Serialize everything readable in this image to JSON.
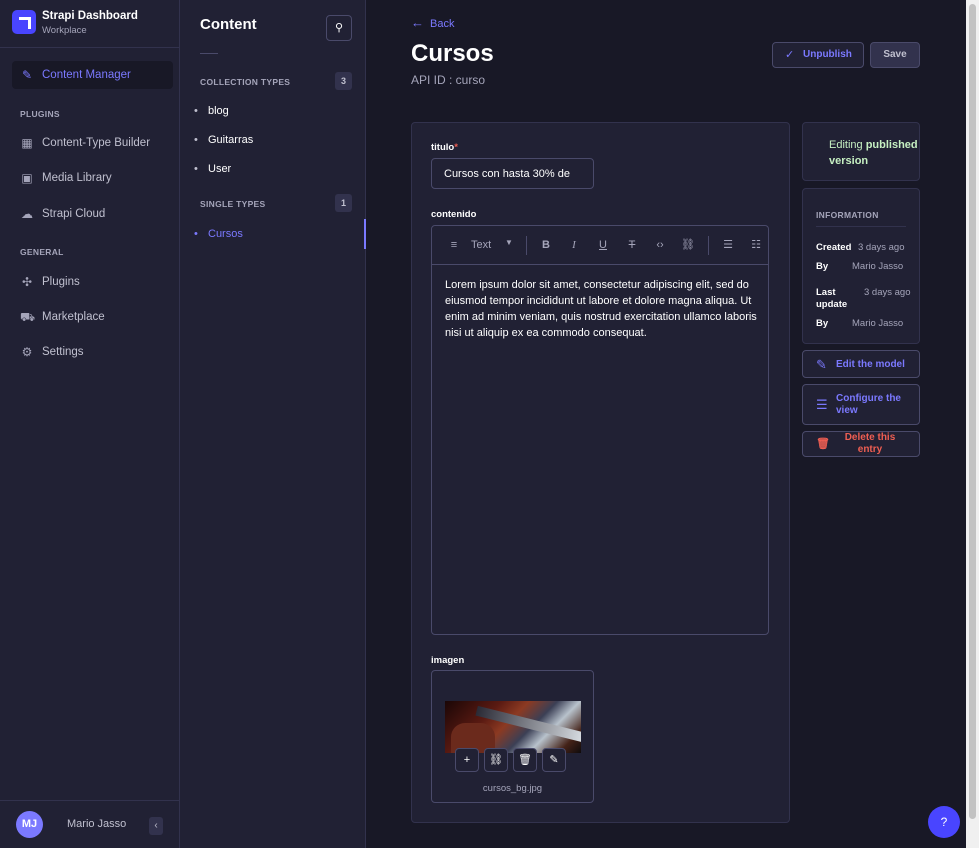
{
  "brand": {
    "title": "Strapi Dashboard",
    "subtitle": "Workplace"
  },
  "main_nav": {
    "content_manager": "Content Manager",
    "plugins_header": "PLUGINS",
    "plugins": [
      {
        "label": "Content-Type Builder",
        "icon": "layout-icon"
      },
      {
        "label": "Media Library",
        "icon": "image-icon"
      },
      {
        "label": "Strapi Cloud",
        "icon": "cloud-icon"
      }
    ],
    "general_header": "GENERAL",
    "general": [
      {
        "label": "Plugins",
        "icon": "puzzle-icon"
      },
      {
        "label": "Marketplace",
        "icon": "cart-icon"
      },
      {
        "label": "Settings",
        "icon": "gear-icon"
      }
    ]
  },
  "profile": {
    "initials": "MJ",
    "name": "Mario Jasso"
  },
  "sub_nav": {
    "title": "Content",
    "collection_header": "COLLECTION TYPES",
    "collection_count": "3",
    "collection_items": [
      "blog",
      "Guitarras",
      "User"
    ],
    "single_header": "SINGLE TYPES",
    "single_count": "1",
    "single_items": [
      "Cursos"
    ]
  },
  "header": {
    "back": "Back",
    "title": "Cursos",
    "api_id": "API ID : curso",
    "unpublish": "Unpublish",
    "save": "Save"
  },
  "form": {
    "titulo_label": "titulo",
    "titulo_required": "*",
    "titulo_value": "Cursos con hasta 30% de",
    "contenido_label": "contenido",
    "toolbar_text": "Text",
    "contenido_value": "Lorem ipsum dolor sit amet, consectetur adipiscing elit, sed do eiusmod tempor incididunt ut labore et dolore magna aliqua. Ut enim ad minim veniam, quis nostrud exercitation ullamco laboris nisi ut aliquip ex ea commodo consequat.",
    "imagen_label": "imagen",
    "image_filename": "cursos_bg.jpg"
  },
  "status": {
    "prefix": "Editing",
    "emphasis": "published version"
  },
  "information": {
    "title": "INFORMATION",
    "created_label": "Created",
    "created_value": "3 days ago",
    "by_label": "By",
    "created_by": "Mario Jasso",
    "updated_label": "Last update",
    "updated_value": "3 days ago",
    "updated_by": "Mario Jasso"
  },
  "actions": {
    "edit_model": "Edit the model",
    "configure_view": "Configure the view",
    "delete_entry": "Delete this entry"
  },
  "help": "?",
  "colors": {
    "accent": "#7b79ff",
    "primary": "#4945ff",
    "danger": "#ee5e52",
    "success_text": "#c6f0c2",
    "background": "#181826",
    "surface": "#212134"
  }
}
